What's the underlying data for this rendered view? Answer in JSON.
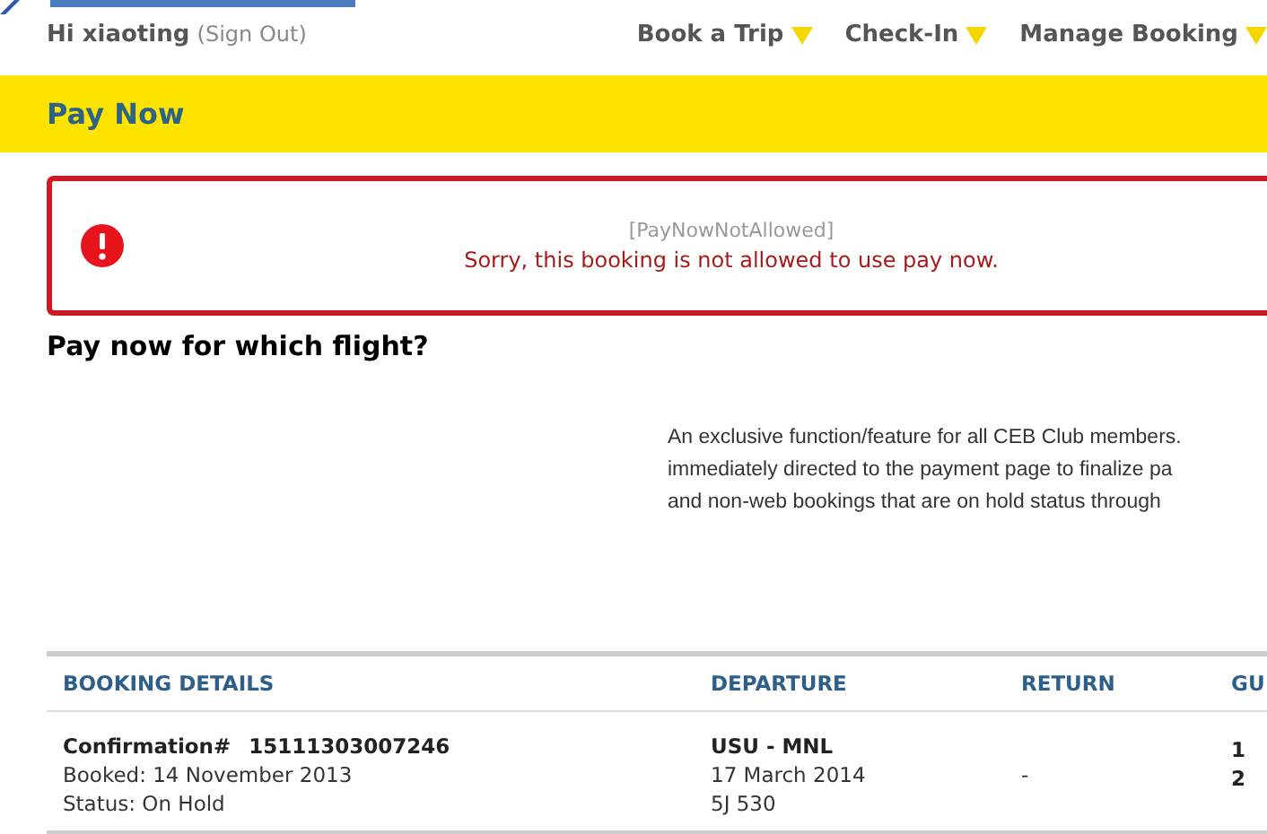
{
  "user": {
    "greeting": "Hi xiaoting",
    "sign_out": "(Sign Out)"
  },
  "nav": [
    {
      "label": "Book a Trip"
    },
    {
      "label": "Check-In"
    },
    {
      "label": "Manage Booking"
    }
  ],
  "page_title": "Pay Now",
  "alert": {
    "code": "[PayNowNotAllowed]",
    "message": "Sorry, this booking is not allowed to use pay now."
  },
  "heading": "Pay now for which flight?",
  "description": [
    "An exclusive function/feature for all CEB Club members.",
    "immediately directed to the payment page to finalize pa",
    "and non-web bookings that are on hold status through"
  ],
  "table": {
    "columns": [
      "BOOKING DETAILS",
      "DEPARTURE",
      "RETURN",
      "GU"
    ],
    "rows": [
      {
        "confirmation_label": "Confirmation#",
        "confirmation": "15111303007246",
        "booked": "Booked: 14 November 2013",
        "status": "Status: On Hold",
        "route": "USU - MNL",
        "date": "17 March 2014",
        "flight": "5J 530",
        "return": "-",
        "guests": [
          "1",
          "2"
        ]
      }
    ]
  }
}
